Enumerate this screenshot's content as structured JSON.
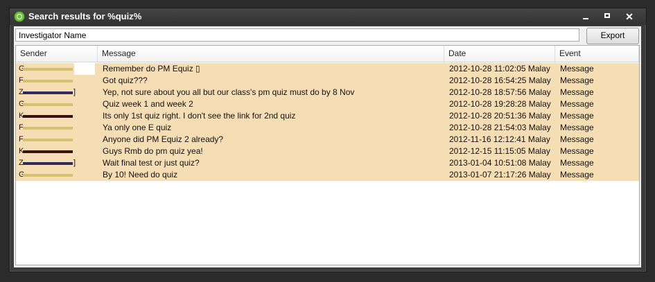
{
  "window": {
    "title": "Search results for %quiz%"
  },
  "search": {
    "value": "Investigator Name"
  },
  "toolbar": {
    "export_label": "Export"
  },
  "table": {
    "columns": [
      "Sender",
      "Message",
      "Date",
      "Event"
    ],
    "rows": [
      {
        "sender_initial": "G",
        "sender_color": "#d4c070",
        "message": "Remember do PM Equiz ▯",
        "date": "2012-10-28 11:02:05 Malay ...",
        "event": "Message"
      },
      {
        "sender_initial": "F",
        "sender_color": "#d4c070",
        "message": "Got quiz???",
        "date": "2012-10-28 16:54:25 Malay ...",
        "event": "Message"
      },
      {
        "sender_initial": "Z",
        "sender_color": "#2e2a5a",
        "sender_suffix": "]",
        "message": "Yep, not sure about you all but our class's pm quiz must do by 8 Nov",
        "date": "2012-10-28 18:57:56 Malay ...",
        "event": "Message"
      },
      {
        "sender_initial": "G",
        "sender_color": "#d4c070",
        "message": "Quiz week 1 and week 2",
        "date": "2012-10-28 19:28:28 Malay ...",
        "event": "Message"
      },
      {
        "sender_initial": "K",
        "sender_color": "#3a1010",
        "message": "Its only 1st quiz right. I don't see the link for 2nd quiz",
        "date": "2012-10-28 20:51:36 Malay ...",
        "event": "Message"
      },
      {
        "sender_initial": "F",
        "sender_color": "#d4c070",
        "message": "Ya only one E quiz",
        "date": "2012-10-28 21:54:03 Malay ...",
        "event": "Message"
      },
      {
        "sender_initial": "F",
        "sender_color": "#d4c070",
        "message": "Anyone did PM Equiz 2 already?",
        "date": "2012-11-16 12:12:41 Malay ...",
        "event": "Message"
      },
      {
        "sender_initial": "K",
        "sender_color": "#3a1010",
        "message": "Guys Rmb do pm quiz yea!",
        "date": "2012-12-15 11:15:05 Malay ...",
        "event": "Message"
      },
      {
        "sender_initial": "Z",
        "sender_color": "#2e2a5a",
        "sender_suffix": "]",
        "message": "Wait final test or just quiz?",
        "date": "2013-01-04 10:51:08 Malay ...",
        "event": "Message"
      },
      {
        "sender_initial": "G",
        "sender_color": "#d4c070",
        "message": "By 10! Need do quiz",
        "date": "2013-01-07 21:17:26 Malay ...",
        "event": "Message"
      }
    ]
  },
  "colors": {
    "row_highlight": "#f5deb3",
    "window_chrome": "#3c3c3c",
    "title_icon": "#6fbf3a"
  },
  "icons": {
    "title": "search-magnifier-icon",
    "minimize": "minimize-icon",
    "maximize": "maximize-icon",
    "close": "close-icon"
  }
}
